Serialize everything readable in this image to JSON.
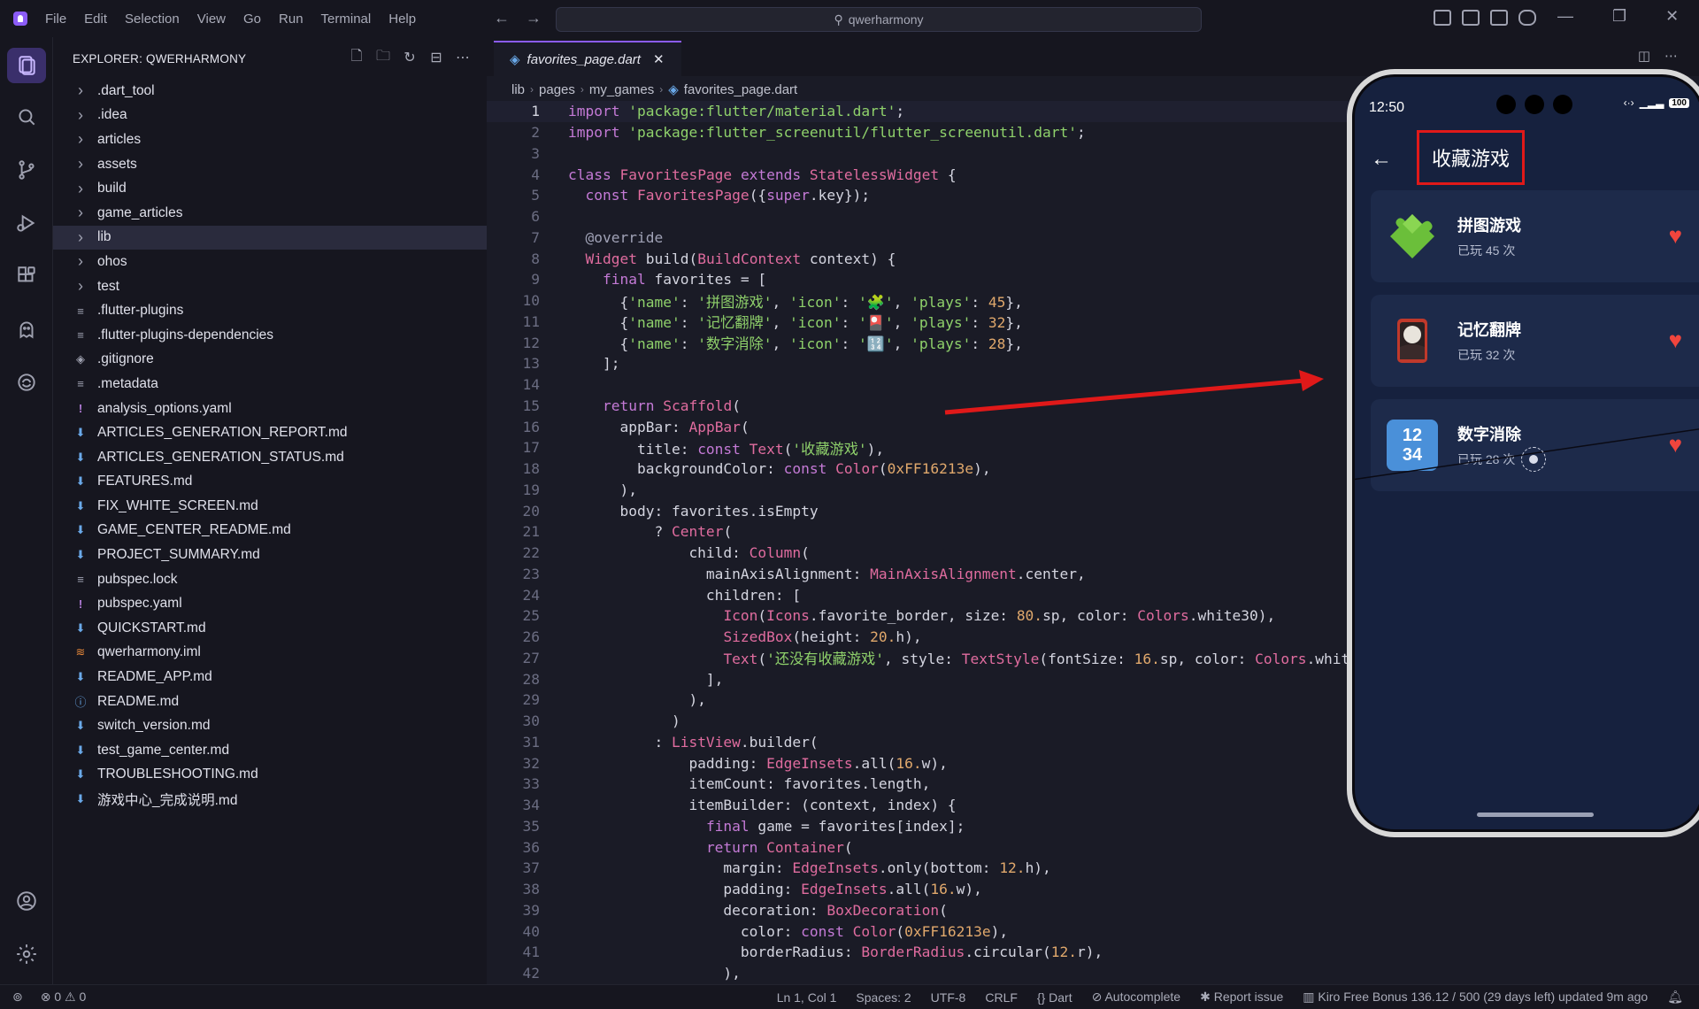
{
  "menu": [
    "File",
    "Edit",
    "Selection",
    "View",
    "Go",
    "Run",
    "Terminal",
    "Help"
  ],
  "search": {
    "text": "qwerharmony"
  },
  "sidebar": {
    "title": "EXPLORER: QWERHARMONY",
    "items": [
      {
        "label": ".dart_tool",
        "kind": "folder"
      },
      {
        "label": ".idea",
        "kind": "folder"
      },
      {
        "label": "articles",
        "kind": "folder"
      },
      {
        "label": "assets",
        "kind": "folder"
      },
      {
        "label": "build",
        "kind": "folder"
      },
      {
        "label": "game_articles",
        "kind": "folder"
      },
      {
        "label": "lib",
        "kind": "folder",
        "selected": true
      },
      {
        "label": "ohos",
        "kind": "folder"
      },
      {
        "label": "test",
        "kind": "folder"
      },
      {
        "label": ".flutter-plugins",
        "kind": "file"
      },
      {
        "label": ".flutter-plugins-dependencies",
        "kind": "file"
      },
      {
        "label": ".gitignore",
        "kind": "git"
      },
      {
        "label": ".metadata",
        "kind": "file"
      },
      {
        "label": "analysis_options.yaml",
        "kind": "yaml"
      },
      {
        "label": "ARTICLES_GENERATION_REPORT.md",
        "kind": "md"
      },
      {
        "label": "ARTICLES_GENERATION_STATUS.md",
        "kind": "md"
      },
      {
        "label": "FEATURES.md",
        "kind": "md"
      },
      {
        "label": "FIX_WHITE_SCREEN.md",
        "kind": "md"
      },
      {
        "label": "GAME_CENTER_README.md",
        "kind": "md"
      },
      {
        "label": "PROJECT_SUMMARY.md",
        "kind": "md"
      },
      {
        "label": "pubspec.lock",
        "kind": "file"
      },
      {
        "label": "pubspec.yaml",
        "kind": "yaml"
      },
      {
        "label": "QUICKSTART.md",
        "kind": "md"
      },
      {
        "label": "qwerharmony.iml",
        "kind": "iml"
      },
      {
        "label": "README_APP.md",
        "kind": "md"
      },
      {
        "label": "README.md",
        "kind": "info"
      },
      {
        "label": "switch_version.md",
        "kind": "md"
      },
      {
        "label": "test_game_center.md",
        "kind": "md"
      },
      {
        "label": "TROUBLESHOOTING.md",
        "kind": "md"
      },
      {
        "label": "游戏中心_完成说明.md",
        "kind": "md"
      }
    ]
  },
  "editor": {
    "tab_label": "favorites_page.dart",
    "breadcrumb": [
      "lib",
      "pages",
      "my_games",
      "favorites_page.dart"
    ]
  },
  "code_lines": [
    "import 'package:flutter/material.dart';",
    "import 'package:flutter_screenutil/flutter_screenutil.dart';",
    "",
    "class FavoritesPage extends StatelessWidget {",
    "  const FavoritesPage({super.key});",
    "",
    "  @override",
    "  Widget build(BuildContext context) {",
    "    final favorites = [",
    "      {'name': '拼图游戏', 'icon': '🧩', 'plays': 45},",
    "      {'name': '记忆翻牌', 'icon': '🎴', 'plays': 32},",
    "      {'name': '数字消除', 'icon': '🔢', 'plays': 28},",
    "    ];",
    "",
    "    return Scaffold(",
    "      appBar: AppBar(",
    "        title: const Text('收藏游戏'),",
    "        backgroundColor: const Color(0xFF16213e),",
    "      ),",
    "      body: favorites.isEmpty",
    "          ? Center(",
    "              child: Column(",
    "                mainAxisAlignment: MainAxisAlignment.center,",
    "                children: [",
    "                  Icon(Icons.favorite_border, size: 80.sp, color: Colors.white30),",
    "                  SizedBox(height: 20.h),",
    "                  Text('还没有收藏游戏', style: TextStyle(fontSize: 16.sp, color: Colors.whit",
    "                ],",
    "              ),",
    "            )",
    "          : ListView.builder(",
    "              padding: EdgeInsets.all(16.w),",
    "              itemCount: favorites.length,",
    "              itemBuilder: (context, index) {",
    "                final game = favorites[index];",
    "                return Container(",
    "                  margin: EdgeInsets.only(bottom: 12.h),",
    "                  padding: EdgeInsets.all(16.w),",
    "                  decoration: BoxDecoration(",
    "                    color: const Color(0xFF16213e),",
    "                    borderRadius: BorderRadius.circular(12.r),",
    "                  ),"
  ],
  "phone": {
    "time": "12:50",
    "battery": "100",
    "appbar_title": "收藏游戏",
    "games": [
      {
        "name": "拼图游戏",
        "plays": "已玩 45 次",
        "icon": "puzzle-icon"
      },
      {
        "name": "记忆翻牌",
        "plays": "已玩 32 次",
        "icon": "card-icon"
      },
      {
        "name": "数字消除",
        "plays": "已玩 28 次",
        "icon": "numbers-icon"
      }
    ],
    "number_icon_text": [
      "12",
      "34"
    ]
  },
  "statusbar": {
    "errors": "0",
    "warnings": "0",
    "position": "Ln 1, Col 1",
    "spaces": "Spaces: 2",
    "encoding": "UTF-8",
    "eol": "CRLF",
    "language": "Dart",
    "autocomplete": "Autocomplete",
    "report": "Report issue",
    "bonus": "Kiro Free Bonus 136.12 / 500 (29 days left) updated 9m ago"
  },
  "colors": {
    "accent": "#8b5cf6",
    "phone_bg": "#16213e",
    "heart": "#f0453d",
    "arrow": "#e01919"
  }
}
